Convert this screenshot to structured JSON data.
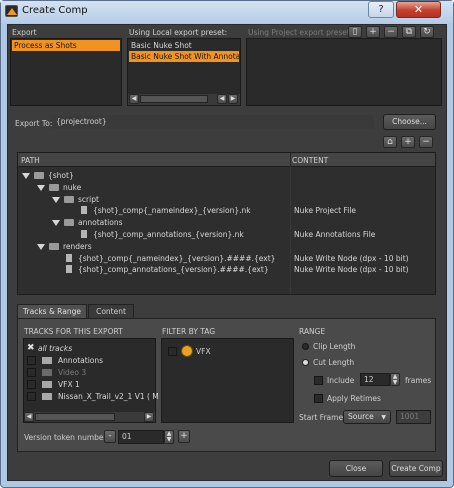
{
  "window": {
    "title": "Create Comp",
    "help": "?",
    "close": "✕"
  },
  "export": {
    "label": "Export",
    "items": [
      {
        "label": "Process as Shots",
        "selected": true
      }
    ],
    "local_label": "Using Local export preset:",
    "local_items": [
      {
        "label": "Basic Nuke Shot",
        "selected": false
      },
      {
        "label": "Basic Nuke Shot With Annotations",
        "selected": true
      }
    ],
    "project_label": "Using Project export preset:"
  },
  "export_to": {
    "label": "Export To:",
    "value": "{projectroot}",
    "button": "Choose..."
  },
  "tree": {
    "col_path": "PATH",
    "col_content": "CONTENT",
    "rows": [
      {
        "depth": 0,
        "type": "folder",
        "name": "{shot}",
        "content": ""
      },
      {
        "depth": 1,
        "type": "folder",
        "name": "nuke",
        "content": ""
      },
      {
        "depth": 2,
        "type": "folder",
        "name": "script",
        "content": ""
      },
      {
        "depth": 3,
        "type": "file",
        "name": "{shot}_comp{_nameindex}_{version}.nk",
        "content": "Nuke Project File"
      },
      {
        "depth": 2,
        "type": "folder",
        "name": "annotations",
        "content": ""
      },
      {
        "depth": 3,
        "type": "file",
        "name": "{shot}_comp_annotations_{version}.nk",
        "content": "Nuke Annotations File"
      },
      {
        "depth": 1,
        "type": "folder",
        "name": "renders",
        "content": ""
      },
      {
        "depth": 2,
        "type": "file",
        "name": "{shot}_comp{_nameindex}_{version}.####.{ext}",
        "content": "Nuke Write Node (dpx - 10 bit)"
      },
      {
        "depth": 2,
        "type": "file",
        "name": "{shot}_comp_annotations_{version}.####.{ext}",
        "content": "Nuke Write Node (dpx - 10 bit)"
      }
    ]
  },
  "tabs": [
    {
      "label": "Tracks & Range",
      "active": true
    },
    {
      "label": "Content",
      "active": false
    }
  ],
  "tracks": {
    "label": "TRACKS FOR THIS EXPORT",
    "items": [
      {
        "label": "all tracks",
        "checked": true,
        "dim": false,
        "italic": true
      },
      {
        "label": "Annotations",
        "checked": false,
        "dim": false,
        "italic": false
      },
      {
        "label": "Video 3",
        "checked": false,
        "dim": true,
        "italic": false
      },
      {
        "label": "VFX 1",
        "checked": false,
        "dim": false,
        "italic": false
      },
      {
        "label": "Nissan_X_Trail_v2_1 V1  ( M",
        "checked": false,
        "dim": false,
        "italic": false
      }
    ]
  },
  "filter": {
    "label": "FILTER BY TAG",
    "items": [
      {
        "label": "VFX"
      }
    ]
  },
  "range": {
    "label": "RANGE",
    "clip_length": "Clip Length",
    "cut_length": "Cut Length",
    "include": "Include",
    "include_value": "12",
    "frames": "frames",
    "apply_retimes": "Apply Retimes",
    "start_frame": "Start Frame",
    "start_source": "Source",
    "start_value": "1001"
  },
  "version": {
    "label": "Version token number",
    "value": "01",
    "minus": "-",
    "plus": "+"
  },
  "footer": {
    "close": "Close",
    "create": "Create Comp"
  }
}
